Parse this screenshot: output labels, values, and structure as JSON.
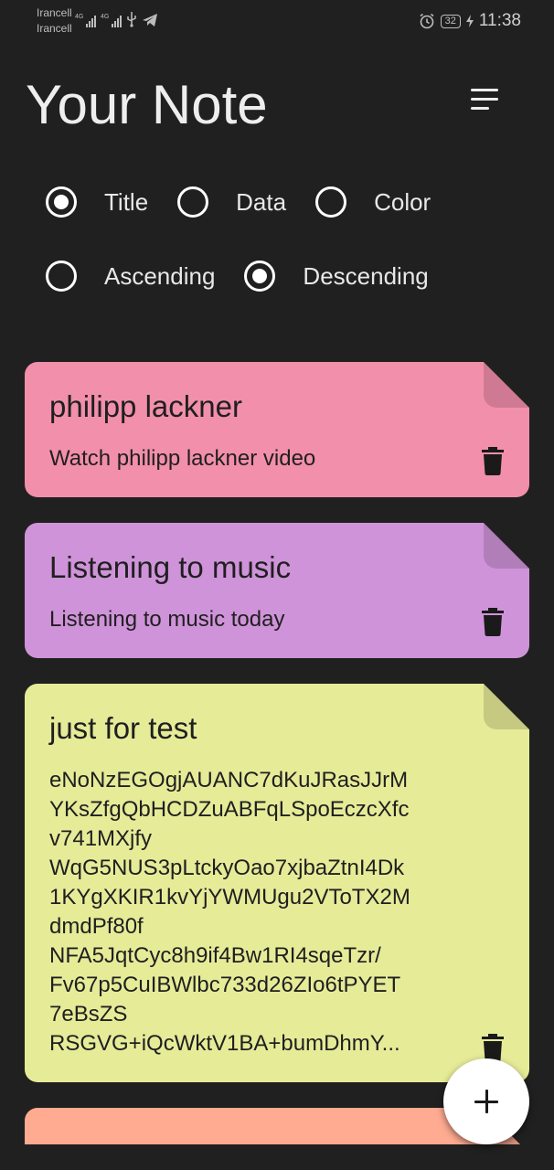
{
  "status_bar": {
    "carrier1": "Irancell",
    "carrier2": "Irancell",
    "network1": "4G",
    "network2": "4G",
    "battery": "32",
    "time": "11:38",
    "icons": [
      "signal-icon",
      "usb-icon",
      "telegram-icon",
      "alarm-icon",
      "charging-icon"
    ]
  },
  "header": {
    "title": "Your Note",
    "sort_icon": "sort-icon"
  },
  "sort_options": {
    "order_by": [
      {
        "label": "Title",
        "checked": true
      },
      {
        "label": "Data",
        "checked": false
      },
      {
        "label": "Color",
        "checked": false
      }
    ],
    "direction": [
      {
        "label": "Ascending",
        "checked": false
      },
      {
        "label": "Descending",
        "checked": true
      }
    ]
  },
  "notes": [
    {
      "title": "philipp lackner",
      "content": "Watch philipp lackner video",
      "color": "#f28fab"
    },
    {
      "title": "Listening to music",
      "content": "Listening to music today",
      "color": "#cf93d9"
    },
    {
      "title": "just for test",
      "content": "eNoNzEGOgjAUANC7dKuJRasJJrM\nYKsZfgQbHCDZuABFqLSpoEczcXfc\nv741MXjfy\nWqG5NUS3pLtckyOao7xjbaZtnI4Dk\n1KYgXKIR1kvYjYWMUgu2VToTX2M\ndmdPf80f\nNFA5JqtCyc8h9if4Bw1RI4sqeTzr/\nFv67p5CuIBWlbc733d26ZIo6tPYET\n7eBsZS\nRSGVG+iQcWktV1BA+bumDhmY...",
      "color": "#e6eb98"
    },
    {
      "title": "",
      "content": "",
      "color": "#ffab91"
    }
  ],
  "fab": {
    "icon": "plus-icon"
  }
}
